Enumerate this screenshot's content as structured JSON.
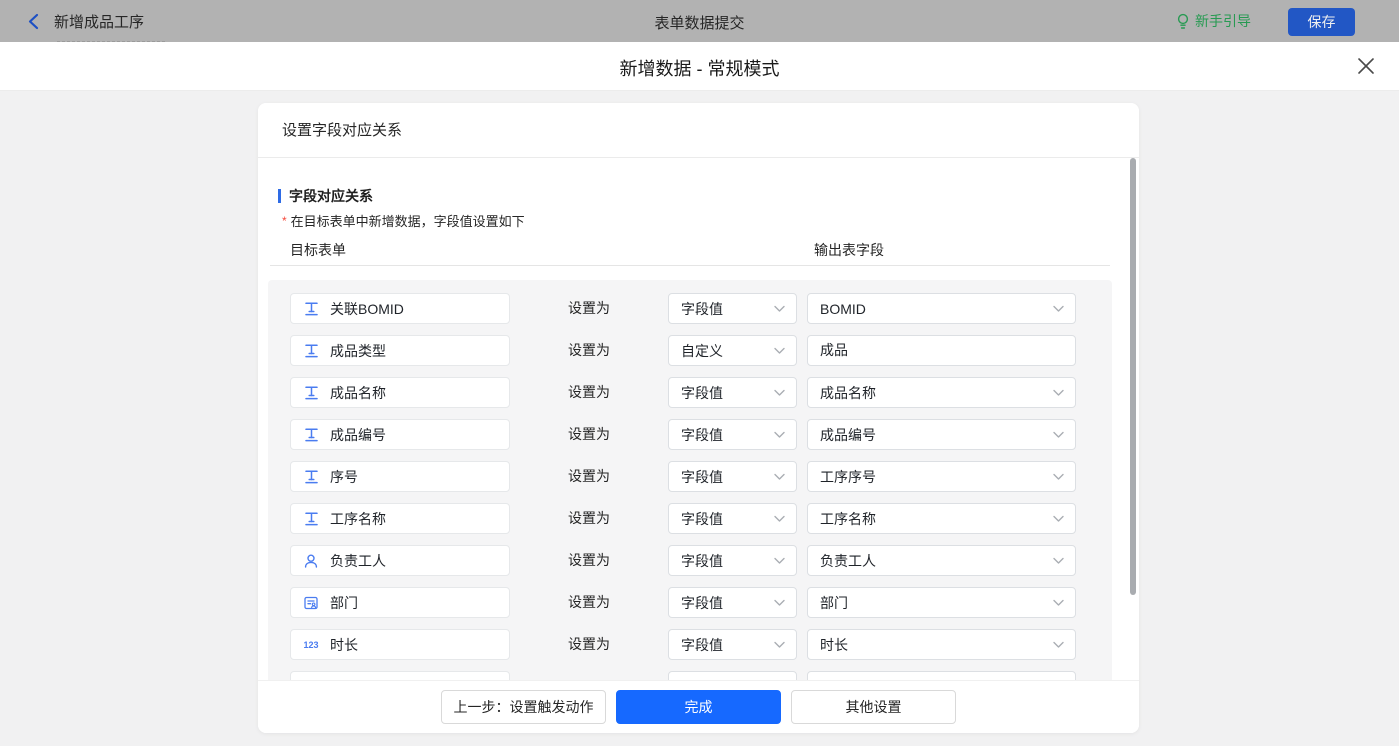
{
  "topbar": {
    "back_title": "新增成品工序",
    "center_title": "表单数据提交",
    "guide_label": "新手引导",
    "save_label": "保存"
  },
  "modal": {
    "title": "新增数据 - 常规模式",
    "close_icon": "close-x"
  },
  "card": {
    "header_title": "设置字段对应关系",
    "section_title": "字段对应关系",
    "note": "在目标表单中新增数据，字段值设置如下",
    "note_asterisk": "*",
    "column_left": "目标表单",
    "column_right": "输出表字段",
    "set_as_label": "设置为",
    "rows": [
      {
        "icon": "text",
        "field": "关联BOMID",
        "mode": "字段值",
        "target": "BOMID",
        "target_type": "select"
      },
      {
        "icon": "text",
        "field": "成品类型",
        "mode": "自定义",
        "target": "成品",
        "target_type": "input"
      },
      {
        "icon": "text",
        "field": "成品名称",
        "mode": "字段值",
        "target": "成品名称",
        "target_type": "select"
      },
      {
        "icon": "text",
        "field": "成品编号",
        "mode": "字段值",
        "target": "成品编号",
        "target_type": "select"
      },
      {
        "icon": "text",
        "field": "序号",
        "mode": "字段值",
        "target": "工序序号",
        "target_type": "select"
      },
      {
        "icon": "text",
        "field": "工序名称",
        "mode": "字段值",
        "target": "工序名称",
        "target_type": "select"
      },
      {
        "icon": "user",
        "field": "负责工人",
        "mode": "字段值",
        "target": "负责工人",
        "target_type": "select"
      },
      {
        "icon": "dept",
        "field": "部门",
        "mode": "字段值",
        "target": "部门",
        "target_type": "select"
      },
      {
        "icon": "number",
        "field": "时长",
        "mode": "字段值",
        "target": "时长",
        "target_type": "select"
      },
      {
        "icon": "none",
        "field": "",
        "mode": "",
        "target": "",
        "target_type": "select",
        "partial": true
      }
    ],
    "number_icon_text": "123",
    "footer": {
      "prev_label": "上一步：设置触发动作",
      "done_label": "完成",
      "other_label": "其他设置"
    }
  },
  "colors": {
    "accent_blue": "#1669ff",
    "field_icon_blue": "#4a7cf0",
    "section_bar_blue": "#2e6be5",
    "guide_green": "#279a52",
    "asterisk_red": "#f5483b",
    "save_button_dimmed": "#2257c5",
    "back_arrow_blue": "#1d50c4",
    "topbar_dimmed_gray": "#b2b2b2"
  }
}
